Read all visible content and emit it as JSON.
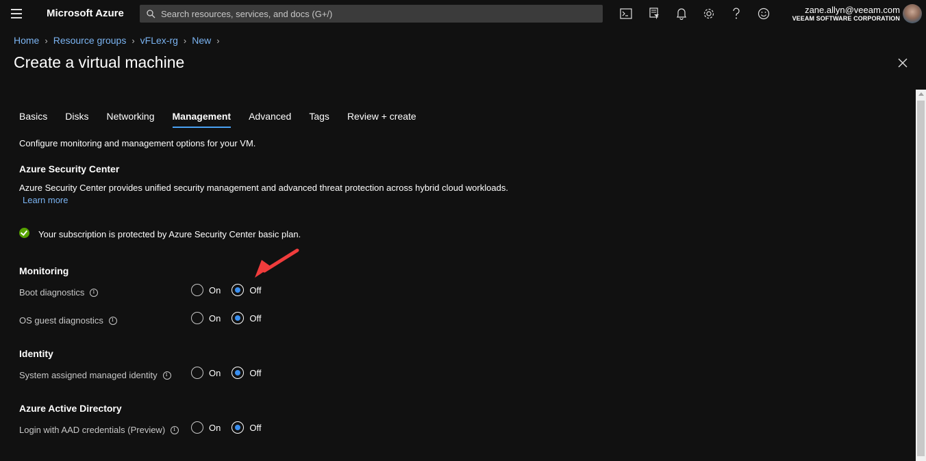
{
  "header": {
    "brand": "Microsoft Azure",
    "search_placeholder": "Search resources, services, and docs (G+/)",
    "user_email": "zane.allyn@veeam.com",
    "user_org": "VEEAM SOFTWARE CORPORATION",
    "icons": [
      "cloud-shell-icon",
      "directory-filter-icon",
      "notifications-icon",
      "settings-icon",
      "help-icon",
      "feedback-icon"
    ]
  },
  "breadcrumb": [
    "Home",
    "Resource groups",
    "vFLex-rg",
    "New"
  ],
  "page_title": "Create a virtual machine",
  "tabs": [
    {
      "label": "Basics",
      "active": false
    },
    {
      "label": "Disks",
      "active": false
    },
    {
      "label": "Networking",
      "active": false
    },
    {
      "label": "Management",
      "active": true
    },
    {
      "label": "Advanced",
      "active": false
    },
    {
      "label": "Tags",
      "active": false
    },
    {
      "label": "Review + create",
      "active": false
    }
  ],
  "intro": "Configure monitoring and management options for your VM.",
  "security_center": {
    "title": "Azure Security Center",
    "description": "Azure Security Center provides unified security management and advanced threat protection across hybrid cloud workloads.",
    "learn_more": "Learn more",
    "status": "Your subscription is protected by Azure Security Center basic plan."
  },
  "monitoring": {
    "title": "Monitoring",
    "boot_diagnostics": {
      "label": "Boot diagnostics",
      "value": "Off"
    },
    "os_guest_diagnostics": {
      "label": "OS guest diagnostics",
      "value": "Off"
    }
  },
  "identity": {
    "title": "Identity",
    "system_identity": {
      "label": "System assigned managed identity",
      "value": "Off"
    }
  },
  "aad": {
    "title": "Azure Active Directory",
    "login_aad": {
      "label": "Login with AAD credentials (Preview)",
      "value": "Off"
    }
  },
  "radio_options": {
    "on": "On",
    "off": "Off"
  },
  "colors": {
    "accent": "#3a8ff0",
    "link": "#7bb4f2",
    "success": "#57a300",
    "annotation_arrow": "#f03c3c"
  }
}
